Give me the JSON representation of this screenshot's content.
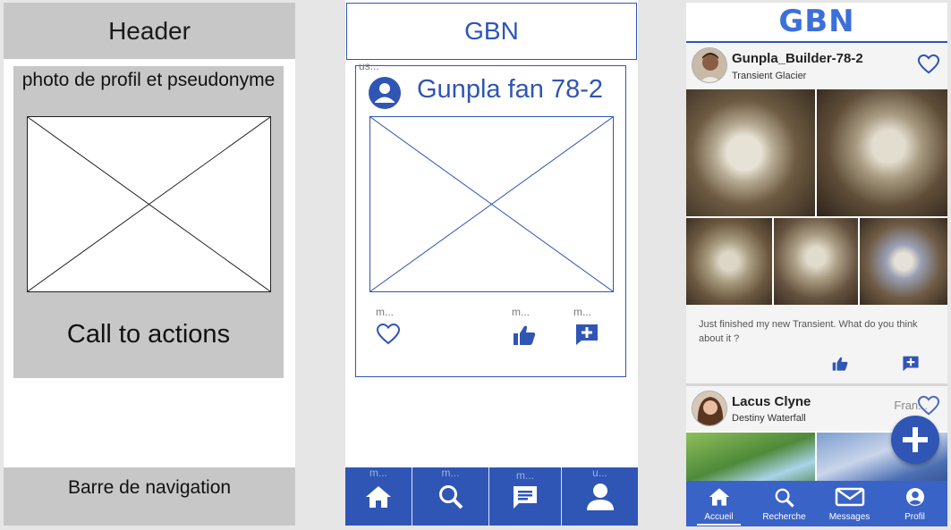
{
  "panel_grey": {
    "header": "Header",
    "card_caption": "photo de profil et pseudonyme",
    "cta": "Call to actions",
    "nav": "Barre de navigation"
  },
  "panel_blue": {
    "header": "GBN",
    "card_top_stub": "us...",
    "username": "Gunpla fan 78-2",
    "action_stubs": [
      "m...",
      "m...",
      "m..."
    ],
    "nav_stubs": [
      "m...",
      "m...",
      "m...",
      "u..."
    ]
  },
  "panel_mockup": {
    "logo": "GBN",
    "post1": {
      "username": "Gunpla_Builder-78-2",
      "kit": "Transient Glacier",
      "caption": "Just finished my new Transient. What do you think about it ?"
    },
    "post2": {
      "username": "Lacus Clyne",
      "kit": "Destiny Waterfall",
      "badge": "Fran..."
    },
    "tabs": [
      "Accueil",
      "Recherche",
      "Messages",
      "Profil"
    ]
  },
  "colors": {
    "wire_grey": "#c7c7c7",
    "brand_blue": "#2f55b5",
    "logo_blue": "#3d6fd9",
    "tab_blue": "#3a63c7"
  }
}
